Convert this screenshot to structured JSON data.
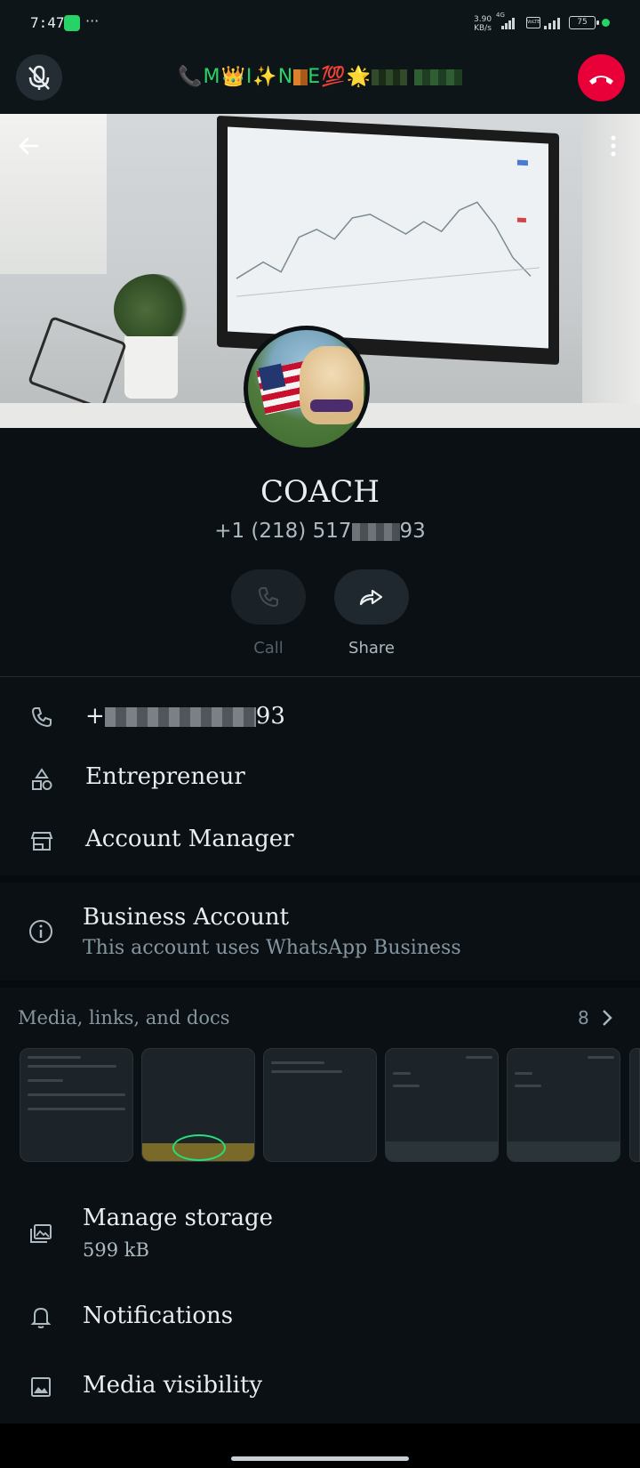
{
  "status_bar": {
    "time": "7:47",
    "dots": "···",
    "net_speed_value": "3.90",
    "net_speed_unit": "KB/s",
    "network": "4G",
    "volte": "VoLTE",
    "battery": "75"
  },
  "call_bar": {
    "caller_display": "📞M👑I✨N",
    "caller_e": "E💯🌟"
  },
  "profile": {
    "name": "COACH",
    "phone_prefix": "+1 (218) 517",
    "phone_suffix": "93"
  },
  "actions": {
    "call_label": "Call",
    "share_label": "Share"
  },
  "details": {
    "phone_prefix": "+",
    "phone_suffix": "93",
    "category": "Entrepreneur",
    "title": "Account Manager"
  },
  "business": {
    "title": "Business Account",
    "subtitle": "This account uses WhatsApp Business"
  },
  "media": {
    "title": "Media, links, and docs",
    "count": "8"
  },
  "storage": {
    "title": "Manage storage",
    "size": "599 kB"
  },
  "notifications": {
    "title": "Notifications"
  },
  "media_visibility": {
    "title": "Media visibility"
  },
  "colors": {
    "background": "#0b1014",
    "accent_green": "#25d366",
    "end_call_red": "#ea0038",
    "secondary_text": "#8696a0"
  }
}
